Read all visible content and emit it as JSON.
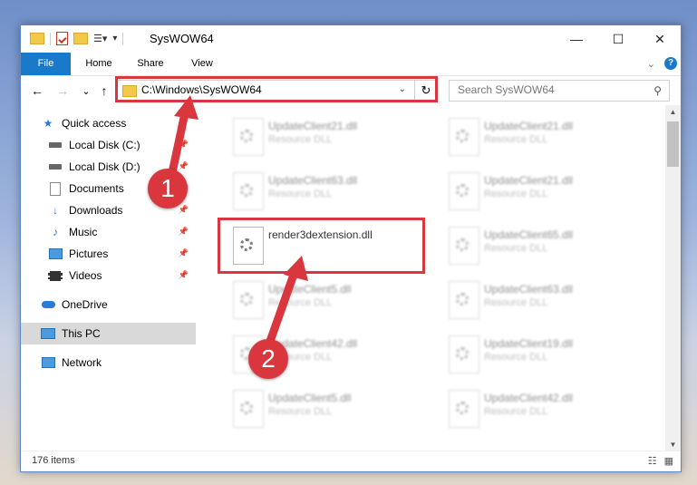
{
  "window": {
    "title": "SysWOW64",
    "minimize": "—",
    "maximize": "☐",
    "close": "✕"
  },
  "ribbon": {
    "tabs": [
      "File",
      "Home",
      "Share",
      "View"
    ],
    "collapse_icon": "chevron-down-icon",
    "help_label": "?"
  },
  "navigation": {
    "back": "←",
    "forward": "→",
    "recent": "⌄",
    "up": "↑",
    "address": "C:\\Windows\\SysWOW64",
    "search_placeholder": "Search SysWOW64"
  },
  "sidebar": {
    "items": [
      {
        "label": "Quick access",
        "icon": "star-icon",
        "pinned": false
      },
      {
        "label": "Local Disk (C:)",
        "icon": "drive-icon",
        "pinned": true
      },
      {
        "label": "Local Disk (D:)",
        "icon": "drive-icon",
        "pinned": true
      },
      {
        "label": "Documents",
        "icon": "documents-icon",
        "pinned": true
      },
      {
        "label": "Downloads",
        "icon": "download-icon",
        "pinned": true
      },
      {
        "label": "Music",
        "icon": "music-icon",
        "pinned": true
      },
      {
        "label": "Pictures",
        "icon": "pictures-icon",
        "pinned": true
      },
      {
        "label": "Videos",
        "icon": "videos-icon",
        "pinned": true
      },
      {
        "label": "OneDrive",
        "icon": "cloud-icon",
        "pinned": false
      },
      {
        "label": "This PC",
        "icon": "computer-icon",
        "pinned": false,
        "selected": true
      },
      {
        "label": "Network",
        "icon": "network-icon",
        "pinned": false
      }
    ]
  },
  "files": {
    "left": [
      {
        "name": "UpdateClient21.dll",
        "type": "Resource DLL"
      },
      {
        "name": "UpdateClient63.dll",
        "type": "Resource DLL"
      },
      {
        "name": "render3dextension.dll",
        "type": ""
      },
      {
        "name": "UpdateClient5.dll",
        "type": "Resource DLL"
      },
      {
        "name": "UpdateClient42.dll",
        "type": "Resource DLL"
      },
      {
        "name": "UpdateClient5.dll",
        "type": "Resource DLL"
      }
    ],
    "right": [
      {
        "name": "UpdateClient21.dll",
        "type": "Resource DLL"
      },
      {
        "name": "UpdateClient21.dll",
        "type": "Resource DLL"
      },
      {
        "name": "UpdateClient65.dll",
        "type": "Resource DLL"
      },
      {
        "name": "UpdateClient63.dll",
        "type": "Resource DLL"
      },
      {
        "name": "UpdateClient19.dll",
        "type": "Resource DLL"
      },
      {
        "name": "UpdateClient42.dll",
        "type": "Resource DLL"
      }
    ]
  },
  "status": {
    "item_count": "176 items"
  },
  "annotations": {
    "step1": "1",
    "step2": "2",
    "highlight_color": "#d9363e"
  }
}
